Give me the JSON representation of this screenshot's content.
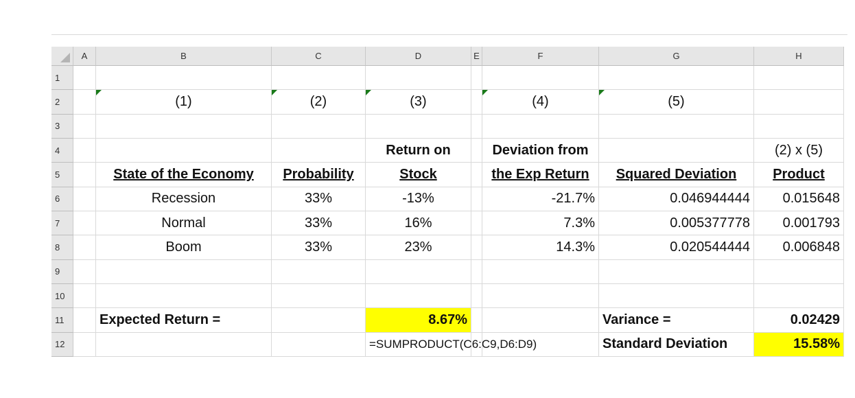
{
  "columns": [
    "A",
    "B",
    "C",
    "D",
    "E",
    "F",
    "G",
    "H"
  ],
  "rows": [
    {
      "num": "1",
      "cells": []
    },
    {
      "num": "2",
      "cells": [
        {
          "col": "B",
          "text": "(1)",
          "align": "c",
          "flag": true
        },
        {
          "col": "C",
          "text": "(2)",
          "align": "c",
          "flag": true
        },
        {
          "col": "D",
          "text": "(3)",
          "align": "c",
          "flag": true
        },
        {
          "col": "F",
          "text": "(4)",
          "align": "c",
          "flag": true
        },
        {
          "col": "G",
          "text": "(5)",
          "align": "c",
          "flag": true
        }
      ]
    },
    {
      "num": "3",
      "cells": []
    },
    {
      "num": "4",
      "cells": [
        {
          "col": "D",
          "text": "Return on",
          "align": "c",
          "bold": true
        },
        {
          "col": "F",
          "text": "Deviation from",
          "align": "c",
          "bold": true
        },
        {
          "col": "H",
          "text": "(2) x (5)",
          "align": "c"
        }
      ]
    },
    {
      "num": "5",
      "cells": [
        {
          "col": "B",
          "text": "State of the Economy",
          "align": "c",
          "bold": true,
          "underline": true
        },
        {
          "col": "C",
          "text": "Probability",
          "align": "c",
          "bold": true,
          "underline": true
        },
        {
          "col": "D",
          "text": "Stock",
          "align": "c",
          "bold": true,
          "underline": true
        },
        {
          "col": "F",
          "text": "the Exp Return",
          "align": "c",
          "bold": true,
          "underline": true
        },
        {
          "col": "G",
          "text": "Squared Deviation",
          "align": "c",
          "bold": true,
          "underline": true
        },
        {
          "col": "H",
          "text": "Product",
          "align": "c",
          "bold": true,
          "underline": true
        }
      ]
    },
    {
      "num": "6",
      "cells": [
        {
          "col": "B",
          "text": "Recession",
          "align": "c"
        },
        {
          "col": "C",
          "text": "33%",
          "align": "c"
        },
        {
          "col": "D",
          "text": "-13%",
          "align": "c"
        },
        {
          "col": "F",
          "text": "-21.7%",
          "align": "r"
        },
        {
          "col": "G",
          "text": "0.046944444",
          "align": "r"
        },
        {
          "col": "H",
          "text": "0.015648",
          "align": "r"
        }
      ]
    },
    {
      "num": "7",
      "cells": [
        {
          "col": "B",
          "text": "Normal",
          "align": "c"
        },
        {
          "col": "C",
          "text": "33%",
          "align": "c"
        },
        {
          "col": "D",
          "text": "16%",
          "align": "c"
        },
        {
          "col": "F",
          "text": "7.3%",
          "align": "r"
        },
        {
          "col": "G",
          "text": "0.005377778",
          "align": "r"
        },
        {
          "col": "H",
          "text": "0.001793",
          "align": "r"
        }
      ]
    },
    {
      "num": "8",
      "cells": [
        {
          "col": "B",
          "text": "Boom",
          "align": "c"
        },
        {
          "col": "C",
          "text": "33%",
          "align": "c"
        },
        {
          "col": "D",
          "text": "23%",
          "align": "c"
        },
        {
          "col": "F",
          "text": "14.3%",
          "align": "r"
        },
        {
          "col": "G",
          "text": "0.020544444",
          "align": "r"
        },
        {
          "col": "H",
          "text": "0.006848",
          "align": "r"
        }
      ]
    },
    {
      "num": "9",
      "cells": []
    },
    {
      "num": "10",
      "cells": []
    },
    {
      "num": "11",
      "cells": [
        {
          "col": "B",
          "text": "Expected Return =",
          "align": "l",
          "bold": true
        },
        {
          "col": "D",
          "text": "8.67%",
          "align": "r",
          "bold": true,
          "fill": "#ffff00"
        },
        {
          "col": "G",
          "text": "Variance =",
          "align": "l",
          "bold": true
        },
        {
          "col": "H",
          "text": "0.02429",
          "align": "r",
          "bold": true
        }
      ]
    },
    {
      "num": "12",
      "cells": [
        {
          "col": "D",
          "text": "=SUMPRODUCT(C6:C9,D6:D9)",
          "align": "l",
          "small": true
        },
        {
          "col": "G",
          "text": "Standard Deviation",
          "align": "l",
          "bold": true
        },
        {
          "col": "H",
          "text": "15.58%",
          "align": "r",
          "bold": true,
          "fill": "#ffff00"
        }
      ]
    }
  ]
}
